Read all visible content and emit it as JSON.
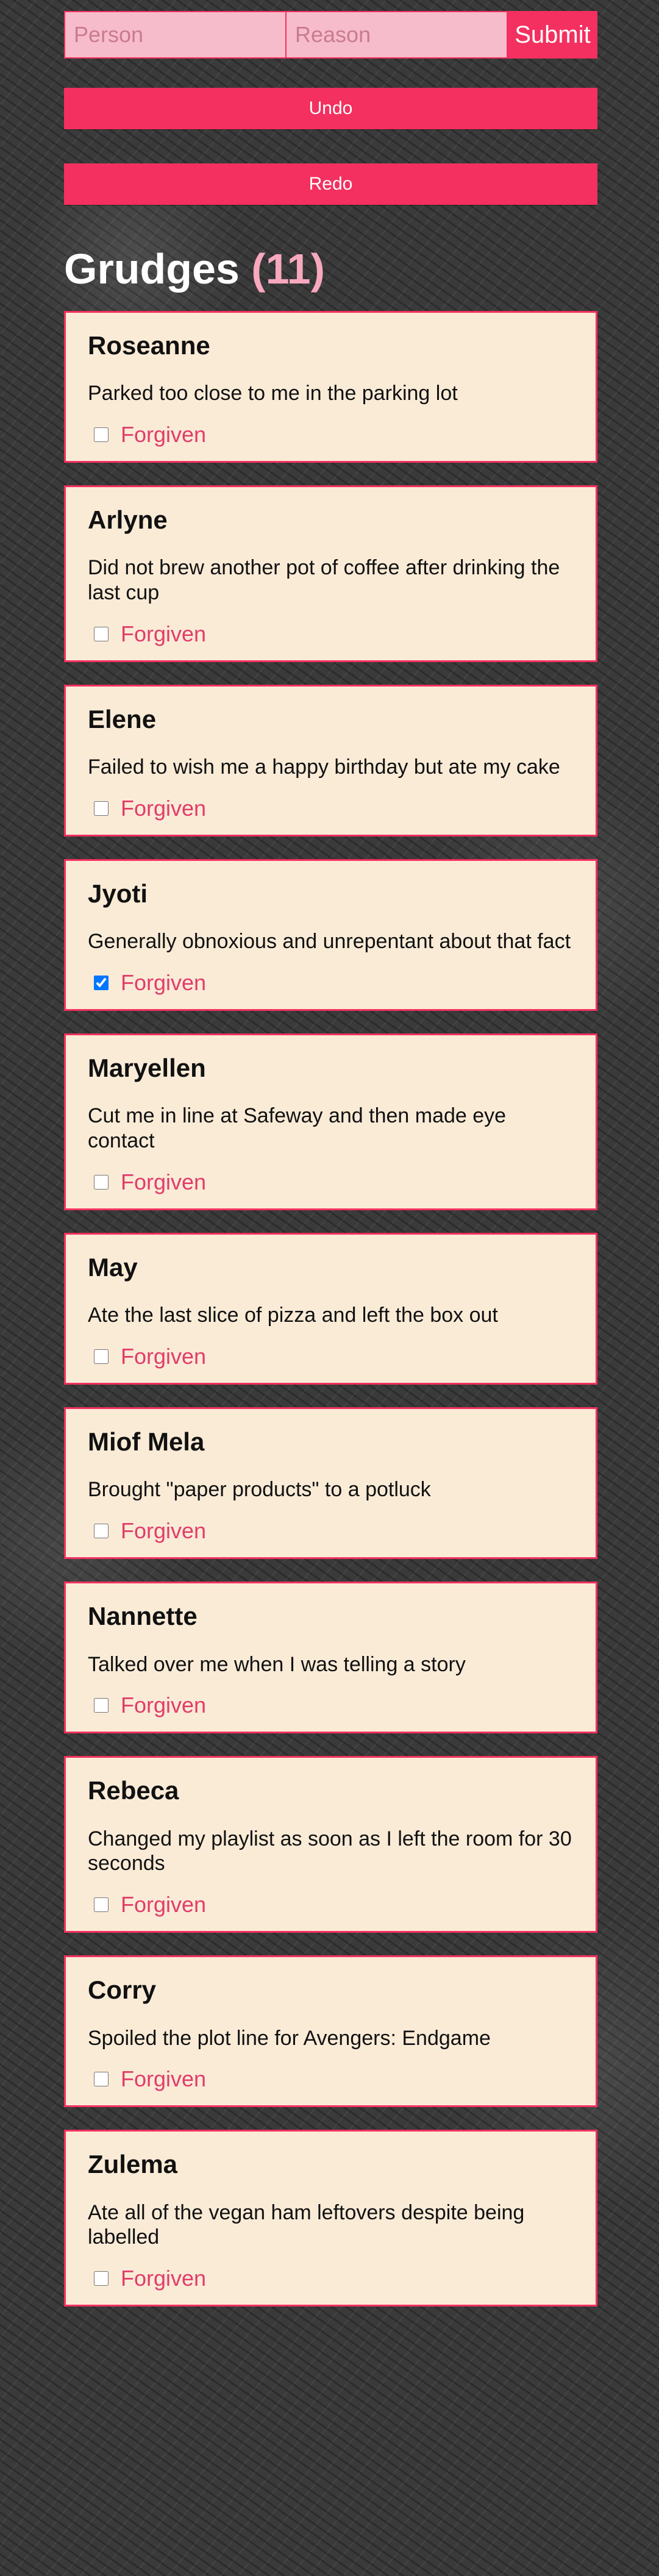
{
  "form": {
    "person_placeholder": "Person",
    "reason_placeholder": "Reason",
    "submit_label": "Submit"
  },
  "controls": {
    "undo_label": "Undo",
    "redo_label": "Redo"
  },
  "header": {
    "title": "Grudges",
    "count": "(11)"
  },
  "colors": {
    "accent": "#f3305f",
    "card_background": "#faebd7",
    "input_background": "#f7bccb"
  },
  "grudges": [
    {
      "person": "Roseanne",
      "reason": "Parked too close to me in the parking lot",
      "forgiven_label": "Forgiven",
      "forgiven": false
    },
    {
      "person": "Arlyne",
      "reason": "Did not brew another pot of coffee after drinking the last cup",
      "forgiven_label": "Forgiven",
      "forgiven": false
    },
    {
      "person": "Elene",
      "reason": "Failed to wish me a happy birthday but ate my cake",
      "forgiven_label": "Forgiven",
      "forgiven": false
    },
    {
      "person": "Jyoti",
      "reason": "Generally obnoxious and unrepentant about that fact",
      "forgiven_label": "Forgiven",
      "forgiven": true
    },
    {
      "person": "Maryellen",
      "reason": "Cut me in line at Safeway and then made eye contact",
      "forgiven_label": "Forgiven",
      "forgiven": false
    },
    {
      "person": "May",
      "reason": "Ate the last slice of pizza and left the box out",
      "forgiven_label": "Forgiven",
      "forgiven": false
    },
    {
      "person": "Miof Mela",
      "reason": "Brought \"paper products\" to a potluck",
      "forgiven_label": "Forgiven",
      "forgiven": false
    },
    {
      "person": "Nannette",
      "reason": "Talked over me when I was telling a story",
      "forgiven_label": "Forgiven",
      "forgiven": false
    },
    {
      "person": "Rebeca",
      "reason": "Changed my playlist as soon as I left the room for 30 seconds",
      "forgiven_label": "Forgiven",
      "forgiven": false
    },
    {
      "person": "Corry",
      "reason": "Spoiled the plot line for Avengers: Endgame",
      "forgiven_label": "Forgiven",
      "forgiven": false
    },
    {
      "person": "Zulema",
      "reason": "Ate all of the vegan ham leftovers despite being labelled",
      "forgiven_label": "Forgiven",
      "forgiven": false
    }
  ]
}
